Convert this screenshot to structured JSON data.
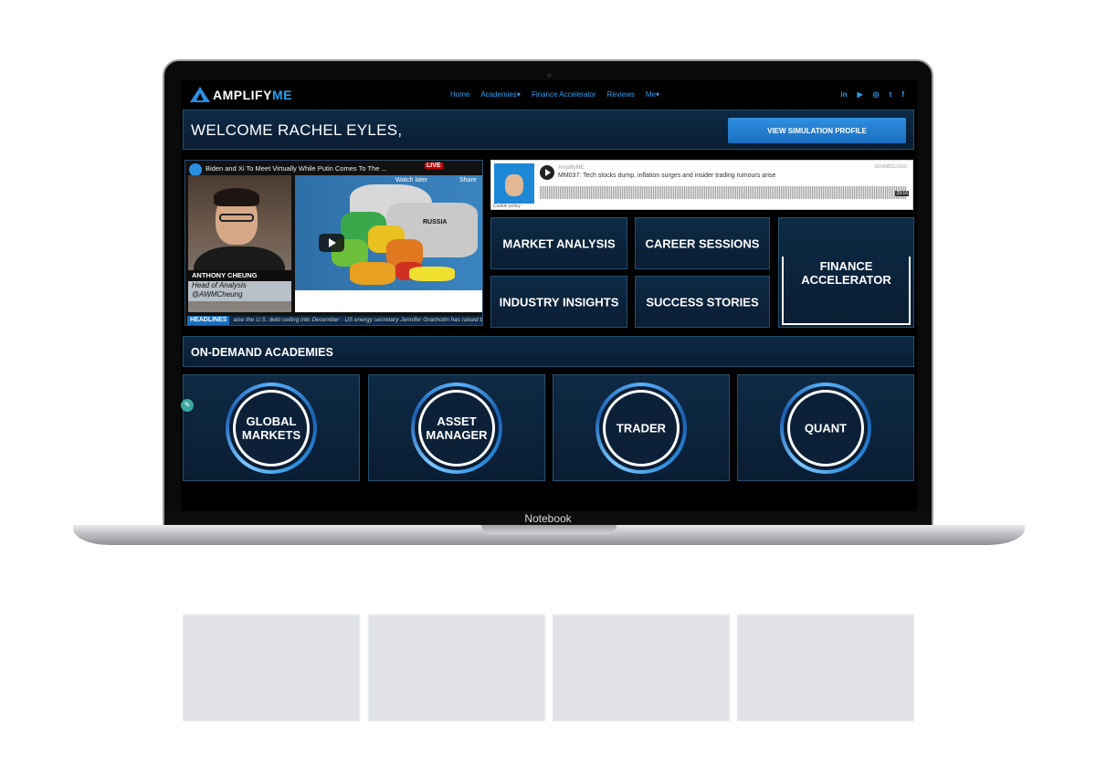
{
  "nav": {
    "logo_a": "AMPLIFY",
    "logo_b": "ME",
    "links": [
      "Home",
      "Academies",
      "Finance Accelerator",
      "Reviews",
      "Me"
    ],
    "social": [
      "in",
      "▶",
      "◎",
      "t",
      "f"
    ]
  },
  "welcome": {
    "text": "WELCOME RACHEL EYLES,",
    "button": "VIEW SIMULATION PROFILE"
  },
  "video": {
    "title": "Biden and Xi To Meet Virtually While Putin Comes To The ...",
    "presenter_name": "ANTHONY CHEUNG",
    "presenter_role": "Head of Analysis",
    "presenter_handle": "@AWMCheung",
    "map_label": "RUSSIA",
    "watch_later": "Watch later",
    "share": "Share",
    "live": "LIVE",
    "headline_tag": "HEADLINES",
    "headline_text": "aise the U.S. debt ceiling into December - US energy secretary Jennifer Granholm has raised the pro"
  },
  "soundcloud": {
    "user": "AmplifyME",
    "track": "MM037: Tech stocks dump, inflation surges and insider trading rumours arise",
    "brand": "SOUNDCLOUD",
    "duration": "29:16",
    "cookie": "Cookie policy"
  },
  "tiles": {
    "market_analysis": "MARKET ANALYSIS",
    "career_sessions": "CAREER SESSIONS",
    "industry_insights": "INDUSTRY INSIGHTS",
    "success_stories": "SUCCESS STORIES",
    "finance_accelerator_1": "FINANCE",
    "finance_accelerator_2": "ACCELERATOR"
  },
  "academies": {
    "title": "ON-DEMAND ACADEMIES",
    "items": [
      {
        "line1": "GLOBAL",
        "line2": "MARKETS"
      },
      {
        "line1": "ASSET",
        "line2": "MANAGER"
      },
      {
        "line1": "TRADER",
        "line2": ""
      },
      {
        "line1": "QUANT",
        "line2": ""
      }
    ]
  },
  "laptop": {
    "label": "Notebook"
  },
  "colors": {
    "accent": "#2a9ff0",
    "panel": "#0e2a45",
    "border": "#24506f"
  }
}
